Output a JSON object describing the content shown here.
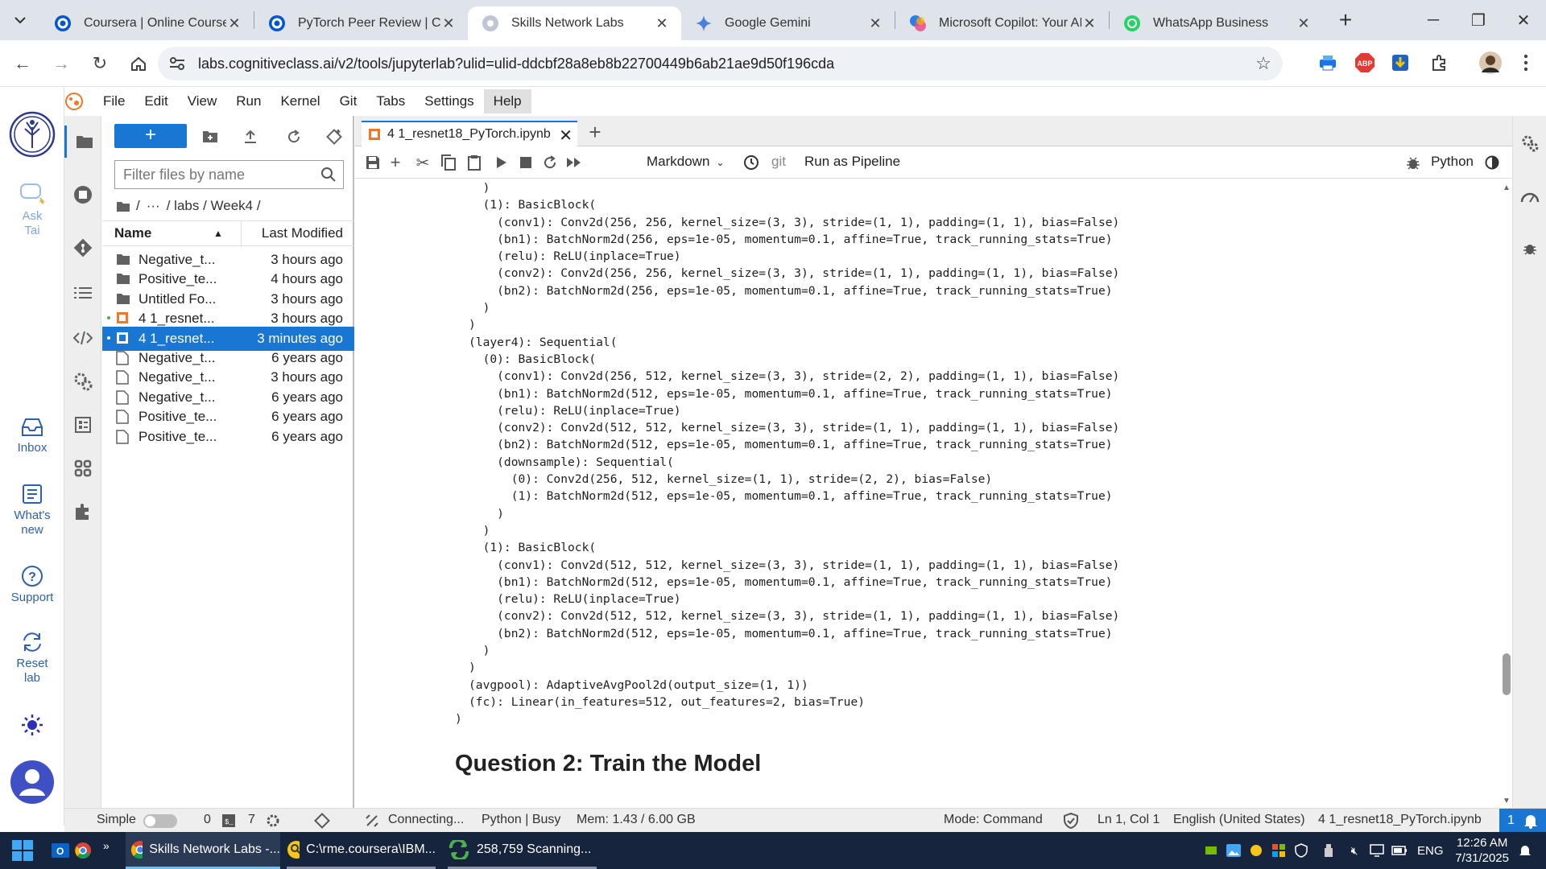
{
  "browser": {
    "tabs": [
      {
        "title": "Coursera | Online Courses"
      },
      {
        "title": "PyTorch Peer Review | Cou"
      },
      {
        "title": "Skills Network Labs"
      },
      {
        "title": "Google Gemini"
      },
      {
        "title": "Microsoft Copilot: Your AI"
      },
      {
        "title": "WhatsApp Business"
      }
    ],
    "url": "labs.cognitiveclass.ai/v2/tools/jupyterlab?ulid=ulid-ddcbf28a8eb8b22700449b6ab21ae9d50f196cda"
  },
  "left_column": {
    "ask_tai": "Ask\nTai",
    "inbox": "Inbox",
    "whats_new": "What's\nnew",
    "support": "Support",
    "reset_lab": "Reset\nlab"
  },
  "menubar": [
    "File",
    "Edit",
    "View",
    "Run",
    "Kernel",
    "Git",
    "Tabs",
    "Settings",
    "Help"
  ],
  "filebrowser": {
    "new_label": "+",
    "filter_placeholder": "Filter files by name",
    "breadcrumb": [
      "/",
      "···",
      "/ labs / Week4 /"
    ],
    "col_name": "Name",
    "col_modified": "Last Modified",
    "files": [
      {
        "name": "Negative_t...",
        "modified": "3 hours ago",
        "type": "folder"
      },
      {
        "name": "Positive_te...",
        "modified": "4 hours ago",
        "type": "folder"
      },
      {
        "name": "Untitled Fo...",
        "modified": "3 hours ago",
        "type": "folder"
      },
      {
        "name": "4 1_resnet...",
        "modified": "3 hours ago",
        "type": "notebook"
      },
      {
        "name": "4 1_resnet...",
        "modified": "3 minutes ago",
        "type": "notebook"
      },
      {
        "name": "Negative_t...",
        "modified": "6 years ago",
        "type": "file"
      },
      {
        "name": "Negative_t...",
        "modified": "3 hours ago",
        "type": "file"
      },
      {
        "name": "Negative_t...",
        "modified": "6 years ago",
        "type": "file"
      },
      {
        "name": "Positive_te...",
        "modified": "6 years ago",
        "type": "file"
      },
      {
        "name": "Positive_te...",
        "modified": "6 years ago",
        "type": "file"
      }
    ]
  },
  "notebook": {
    "tab_title": "4 1_resnet18_PyTorch.ipynb",
    "cell_type": "Markdown",
    "git": "git",
    "run_as_pipeline": "Run as Pipeline",
    "kernel": "Python",
    "output_lines": [
      "  )",
      "  (1): BasicBlock(",
      "    (conv1): Conv2d(256, 256, kernel_size=(3, 3), stride=(1, 1), padding=(1, 1), bias=False)",
      "    (bn1): BatchNorm2d(256, eps=1e-05, momentum=0.1, affine=True, track_running_stats=True)",
      "    (relu): ReLU(inplace=True)",
      "    (conv2): Conv2d(256, 256, kernel_size=(3, 3), stride=(1, 1), padding=(1, 1), bias=False)",
      "    (bn2): BatchNorm2d(256, eps=1e-05, momentum=0.1, affine=True, track_running_stats=True)",
      "  )",
      ")",
      "(layer4): Sequential(",
      "  (0): BasicBlock(",
      "    (conv1): Conv2d(256, 512, kernel_size=(3, 3), stride=(2, 2), padding=(1, 1), bias=False)",
      "    (bn1): BatchNorm2d(512, eps=1e-05, momentum=0.1, affine=True, track_running_stats=True)",
      "    (relu): ReLU(inplace=True)",
      "    (conv2): Conv2d(512, 512, kernel_size=(3, 3), stride=(1, 1), padding=(1, 1), bias=False)",
      "    (bn2): BatchNorm2d(512, eps=1e-05, momentum=0.1, affine=True, track_running_stats=True)",
      "    (downsample): Sequential(",
      "      (0): Conv2d(256, 512, kernel_size=(1, 1), stride=(2, 2), bias=False)",
      "      (1): BatchNorm2d(512, eps=1e-05, momentum=0.1, affine=True, track_running_stats=True)",
      "    )",
      "  )",
      "  (1): BasicBlock(",
      "    (conv1): Conv2d(512, 512, kernel_size=(3, 3), stride=(1, 1), padding=(1, 1), bias=False)",
      "    (bn1): BatchNorm2d(512, eps=1e-05, momentum=0.1, affine=True, track_running_stats=True)",
      "    (relu): ReLU(inplace=True)",
      "    (conv2): Conv2d(512, 512, kernel_size=(3, 3), stride=(1, 1), padding=(1, 1), bias=False)",
      "    (bn2): BatchNorm2d(512, eps=1e-05, momentum=0.1, affine=True, track_running_stats=True)",
      "  )",
      ")",
      "(avgpool): AdaptiveAvgPool2d(output_size=(1, 1))",
      "(fc): Linear(in_features=512, out_features=2, bias=True)"
    ],
    "closing": ")",
    "heading": "Question 2: Train the Model"
  },
  "statusbar": {
    "simple": "Simple",
    "terminals": "0",
    "kernels": "7",
    "connecting": "Connecting...",
    "kernel_status": "Python | Busy",
    "mem": "Mem: 1.43 / 6.00 GB",
    "mode": "Mode: Command",
    "position": "Ln 1, Col 1",
    "language": "English (United States)",
    "file": "4 1_resnet18_PyTorch.ipynb",
    "notifications": "1"
  },
  "taskbar": {
    "items": [
      {
        "label": "Skills Network Labs -..."
      },
      {
        "label": "C:\\rme.coursera\\IBM..."
      },
      {
        "label": "258,759 Scanning..."
      }
    ],
    "lang": "ENG",
    "time": "12:26 AM",
    "date": "7/31/2025"
  }
}
